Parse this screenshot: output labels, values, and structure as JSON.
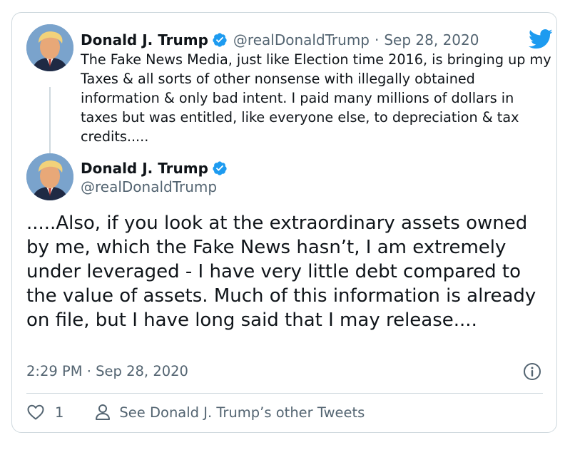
{
  "parent_tweet": {
    "author_name": "Donald J. Trump",
    "handle": "@realDonaldTrump",
    "separator": "·",
    "date": "Sep 28, 2020",
    "text": "The Fake News Media, just like Election time 2016, is bringing up my Taxes & all sorts of other nonsense with illegally obtained information & only bad intent. I paid many millions of dollars in taxes but was entitled, like everyone else, to depreciation & tax credits....."
  },
  "main_tweet": {
    "author_name": "Donald J. Trump",
    "handle": "@realDonaldTrump",
    "text": ".....Also, if you look at the extraordinary assets owned by me, which the Fake News hasn’t, I am extremely under leveraged - I have very little debt compared to the value of assets. Much of this information is already on file, but I have long said that I may release....",
    "timestamp": "2:29 PM · Sep 28, 2020"
  },
  "actions": {
    "like_count": "1",
    "profile_link_label": "See Donald J. Trump’s other Tweets"
  },
  "icons": {
    "verified": "verified-badge-icon",
    "logo": "twitter-bird-icon",
    "info": "info-icon",
    "like": "heart-icon",
    "profile": "person-icon"
  },
  "colors": {
    "twitter_blue": "#1d9bf0",
    "text_primary": "#0f1419",
    "text_secondary": "#536471",
    "border": "#cfd9de"
  }
}
